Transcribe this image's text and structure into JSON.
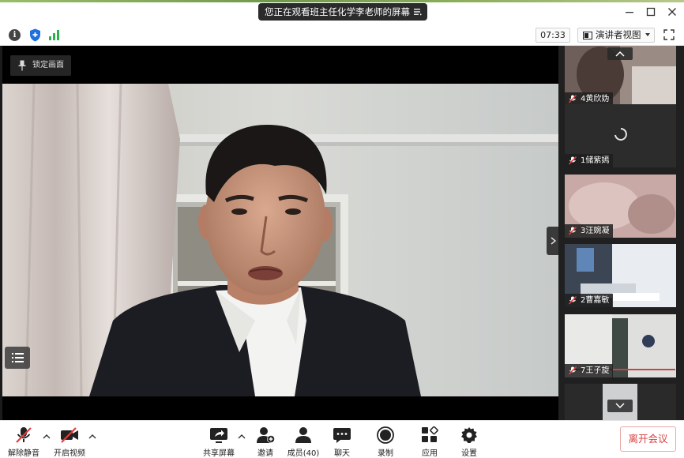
{
  "window": {
    "share_banner": "您正在观看班主任化学李老师的屏幕"
  },
  "status_bar": {
    "timer": "07:33",
    "view_mode": "演讲者视图"
  },
  "main_video": {
    "pin_label": "锁定画面"
  },
  "participants": [
    {
      "name": "4黄欣妫"
    },
    {
      "name": "1储紫嫣"
    },
    {
      "name": "3汪婉凝"
    },
    {
      "name": "2曹嘉敏"
    },
    {
      "name": "7王子旋"
    }
  ],
  "toolbar": {
    "mute_label": "解除静音",
    "video_label": "开启视频",
    "share_label": "共享屏幕",
    "invite_label": "邀请",
    "members_label": "成员(40)",
    "chat_label": "聊天",
    "record_label": "录制",
    "apps_label": "应用",
    "settings_label": "设置",
    "leave_label": "离开会议"
  },
  "colors": {
    "leave_text": "#d94242",
    "signal_green": "#2bb24c",
    "shield_blue": "#1e6fe0",
    "muted_red": "#e23b3b"
  },
  "icons": [
    "info-icon",
    "shield-icon",
    "signal-icon",
    "layout-icon",
    "fullscreen-icon",
    "pin-icon",
    "list-icon",
    "microphone-muted-icon",
    "video-off-icon",
    "share-screen-icon",
    "invite-icon",
    "members-icon",
    "chat-icon",
    "record-icon",
    "apps-icon",
    "settings-icon",
    "loading-spinner-icon"
  ]
}
